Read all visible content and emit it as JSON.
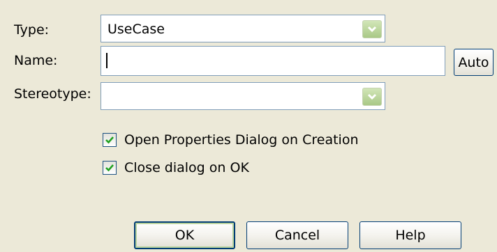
{
  "type": {
    "label": "Type:",
    "value": "UseCase"
  },
  "name": {
    "label": "Name:",
    "value": "",
    "auto_button": "Auto"
  },
  "stereotype": {
    "label": "Stereotype:",
    "value": ""
  },
  "options": {
    "open_properties": {
      "label": "Open Properties Dialog on Creation",
      "checked": true
    },
    "close_on_ok": {
      "label": "Close dialog on OK",
      "checked": true
    }
  },
  "buttons": {
    "ok": "OK",
    "cancel": "Cancel",
    "help": "Help"
  },
  "icons": {
    "dropdown": "chevron-down-icon",
    "check": "checkmark-icon"
  },
  "colors": {
    "dialog_bg": "#ece9d8",
    "field_border": "#7f9db9",
    "button_border": "#003c74",
    "dropdown_green": "#a9c886",
    "checkmark": "#21a121"
  }
}
